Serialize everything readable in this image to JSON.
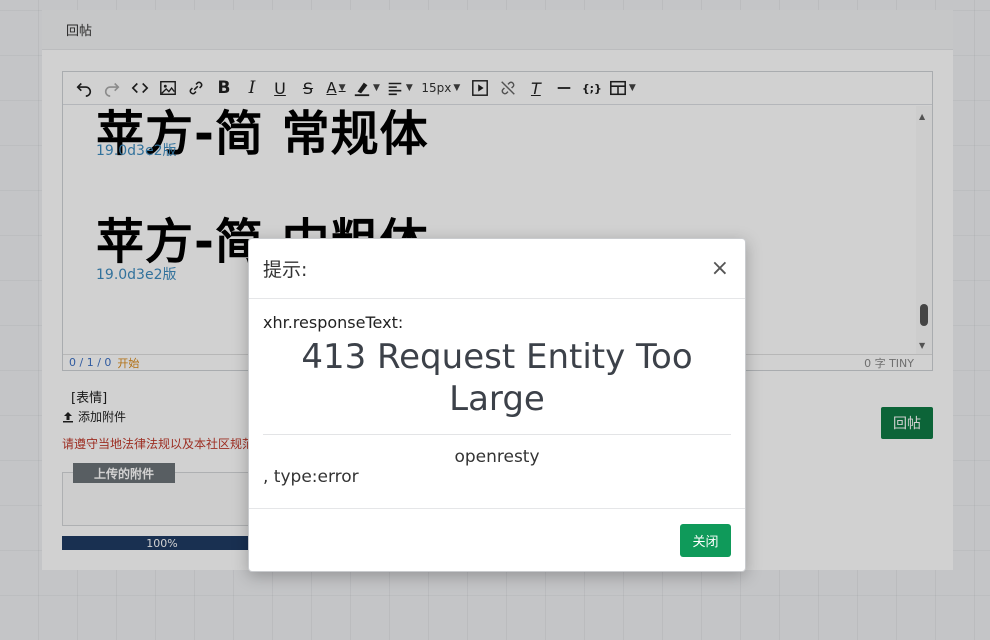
{
  "panel": {
    "title": "回帖"
  },
  "toolbar": {
    "font_size": "15px"
  },
  "editor": {
    "sample1_text": "苹方-简 常规体",
    "sample1_version": "19.0d3e2版",
    "sample2_text": "苹方-简 中粗体",
    "sample2_version": "19.0d3e2版",
    "status_counts": "0 / 1 / 0",
    "status_start": "开始",
    "status_right": "0 字  TINY"
  },
  "below_editor": {
    "emoji": "[表情]",
    "add_attachment": "添加附件",
    "rules_text": "请遵守当地法律法规以及本社区规范",
    "uploaded_attachments": "上传的附件",
    "progress_label": "100%",
    "progress_value": 1.0,
    "reply_button": "回帖"
  },
  "modal": {
    "title": "提示:",
    "close_symbol": "×",
    "response_label": "xhr.responseText:",
    "error_title": "413 Request Entity Too Large",
    "server": "openresty",
    "type_line": ", type:error",
    "close_button": "关闭"
  },
  "colors": {
    "primary_green": "#0f9a5a",
    "reply_green": "#0f7a45",
    "progress_bar": "#1f3b63",
    "warning_red": "#c0392b"
  }
}
